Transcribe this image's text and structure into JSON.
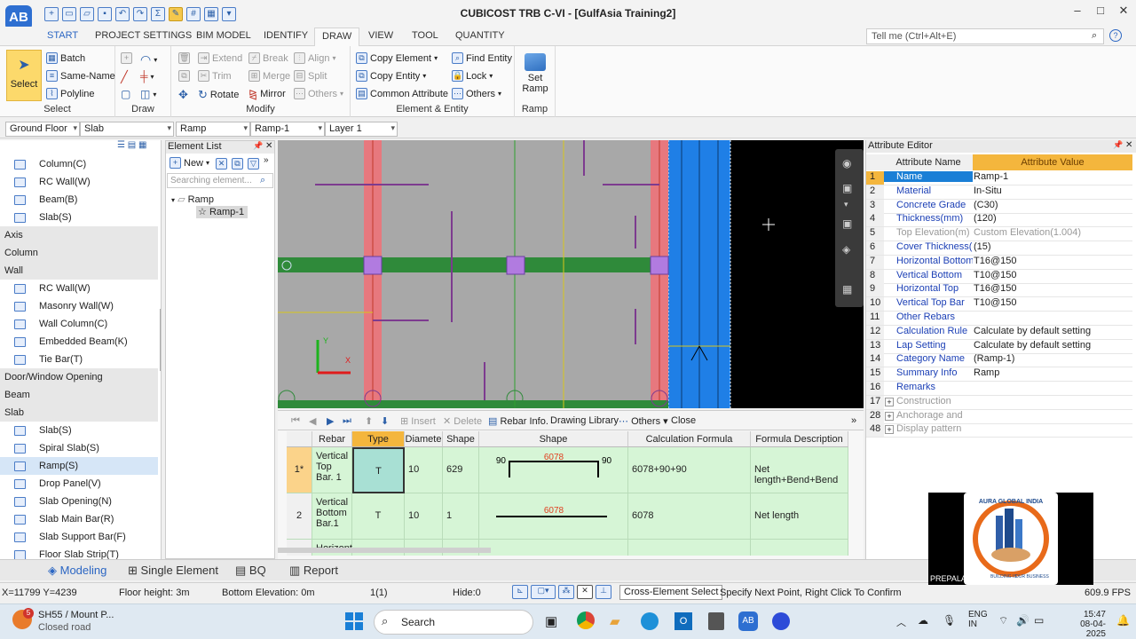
{
  "app": {
    "title": "CUBICOST TRB C-VI - [GulfAsia Training2]",
    "logo": "AB"
  },
  "tabs": [
    "START",
    "PROJECT SETTINGS",
    "BIM MODEL",
    "IDENTIFY",
    "DRAW",
    "VIEW",
    "TOOL",
    "QUANTITY"
  ],
  "active_tab": "DRAW",
  "tellme": {
    "placeholder": "Tell me (Ctrl+Alt+E)"
  },
  "ribbon": {
    "select": {
      "big": "Select",
      "batch": "Batch",
      "same": "Same-Name",
      "poly": "Polyline",
      "label": "Select"
    },
    "draw": {
      "label": "Draw"
    },
    "modify": {
      "extend": "Extend",
      "break": "Break",
      "align": "Align",
      "trim": "Trim",
      "merge": "Merge",
      "split": "Split",
      "rotate": "Rotate",
      "mirror": "Mirror",
      "others": "Others",
      "label": "Modify"
    },
    "element": {
      "copy_el": "Copy Element",
      "find": "Find Entity",
      "copy_ent": "Copy Entity",
      "lock": "Lock",
      "common": "Common Attribute",
      "others": "Others",
      "label": "Element & Entity"
    },
    "ramp": {
      "line1": "Set",
      "line2": "Ramp",
      "label": "Ramp"
    }
  },
  "combos": {
    "floor": "Ground Floor",
    "type": "Slab",
    "elem": "Ramp",
    "name": "Ramp-1",
    "layer": "Layer 1"
  },
  "left_tree": [
    {
      "kind": "item",
      "label": "Column(C)"
    },
    {
      "kind": "item",
      "label": "RC Wall(W)"
    },
    {
      "kind": "item",
      "label": "Beam(B)"
    },
    {
      "kind": "item",
      "label": "Slab(S)"
    },
    {
      "kind": "cat",
      "label": "Axis"
    },
    {
      "kind": "cat",
      "label": "Column"
    },
    {
      "kind": "cat",
      "label": "Wall"
    },
    {
      "kind": "item",
      "label": "RC Wall(W)"
    },
    {
      "kind": "item",
      "label": "Masonry Wall(W)"
    },
    {
      "kind": "item",
      "label": "Wall Column(C)"
    },
    {
      "kind": "item",
      "label": "Embedded Beam(K)"
    },
    {
      "kind": "item",
      "label": "Tie Bar(T)"
    },
    {
      "kind": "cat",
      "label": "Door/Window Opening"
    },
    {
      "kind": "cat",
      "label": "Beam"
    },
    {
      "kind": "cat",
      "label": "Slab"
    },
    {
      "kind": "item",
      "label": "Slab(S)"
    },
    {
      "kind": "item",
      "label": "Spiral Slab(S)"
    },
    {
      "kind": "item",
      "label": "Ramp(S)",
      "selected": true
    },
    {
      "kind": "item",
      "label": "Drop Panel(V)"
    },
    {
      "kind": "item",
      "label": "Slab Opening(N)"
    },
    {
      "kind": "item",
      "label": "Slab Main Bar(R)"
    },
    {
      "kind": "item",
      "label": "Slab Support Bar(F)"
    },
    {
      "kind": "item",
      "label": "Floor Slab Strip(T)"
    }
  ],
  "element_list": {
    "title": "Element List",
    "new": "New",
    "search": "Searching element...",
    "root": "Ramp",
    "child": "Ramp-1"
  },
  "attr_editor": {
    "title": "Attribute Editor",
    "col_name": "Attribute Name",
    "col_value": "Attribute Value",
    "rows": [
      {
        "n": "1",
        "name": "Name",
        "value": "Ramp-1"
      },
      {
        "n": "2",
        "name": "Material",
        "value": "In-Situ"
      },
      {
        "n": "3",
        "name": "Concrete Grade",
        "value": "(C30)"
      },
      {
        "n": "4",
        "name": "Thickness(mm)",
        "value": "(120)"
      },
      {
        "n": "5",
        "name": "Top Elevation(m)",
        "value": "Custom Elevation(1.004)",
        "gray": true
      },
      {
        "n": "6",
        "name": "Cover Thickness(",
        "value": "(15)"
      },
      {
        "n": "7",
        "name": "Horizontal Bottom",
        "value": "T16@150"
      },
      {
        "n": "8",
        "name": "Vertical Bottom",
        "value": "T10@150"
      },
      {
        "n": "9",
        "name": "Horizontal Top",
        "value": "T16@150"
      },
      {
        "n": "10",
        "name": "Vertical Top Bar",
        "value": "T10@150"
      },
      {
        "n": "11",
        "name": "Other Rebars",
        "value": ""
      },
      {
        "n": "12",
        "name": "Calculation Rule",
        "value": "Calculate by default setting"
      },
      {
        "n": "13",
        "name": "Lap Setting",
        "value": "Calculate by default setting"
      },
      {
        "n": "14",
        "name": "Category Name",
        "value": "(Ramp-1)"
      },
      {
        "n": "15",
        "name": "Summary Info",
        "value": "Ramp"
      },
      {
        "n": "16",
        "name": "Remarks",
        "value": ""
      },
      {
        "n": "17",
        "name": "Construction",
        "value": "",
        "gray": true,
        "expand": true
      },
      {
        "n": "28",
        "name": "Anchorage and",
        "value": "",
        "gray": true,
        "expand": true
      },
      {
        "n": "48",
        "name": "Display pattern",
        "value": "",
        "gray": true,
        "expand": true
      }
    ]
  },
  "rebar": {
    "toolbar": {
      "insert": "Insert",
      "delete": "Delete",
      "info": "Rebar Info.",
      "library": "Drawing Library",
      "others": "Others",
      "close": "Close"
    },
    "headers": [
      "Rebar",
      "Type",
      "Diamete",
      "Shape",
      "Shape",
      "Calculation Formula",
      "Formula Description"
    ],
    "rows": [
      {
        "idx": "1*",
        "rebar": "Vertical Top Bar. 1",
        "type": "T",
        "dia": "10",
        "shape": "629",
        "left": "90",
        "mid": "6078",
        "right": "90",
        "formula": "6078+90+90",
        "desc": "Net length+Bend+Bend"
      },
      {
        "idx": "2",
        "rebar": "Vertical Bottom Bar.1",
        "type": "T",
        "dia": "10",
        "shape": "1",
        "left": "",
        "mid": "6078",
        "right": "",
        "formula": "6078",
        "desc": "Net length"
      },
      {
        "idx": "",
        "rebar": "Horizont",
        "type": "",
        "dia": "",
        "shape": "",
        "left": "",
        "mid": "",
        "right": "",
        "formula": "",
        "desc": ""
      }
    ]
  },
  "bottom_tabs": [
    "Modeling",
    "Single Element",
    "BQ",
    "Report"
  ],
  "status": {
    "coords": "X=11799 Y=4239",
    "floor": "Floor height: 3m",
    "bottom": "Bottom Elevation: 0m",
    "count": "1(1)",
    "hide": "Hide:0",
    "cross": "Cross-Element Select",
    "hint": "Specify Next Point, Right Click To Confirm",
    "fps": "609.9 FPS"
  },
  "taskbar": {
    "notif_badge": "5",
    "news_title": "SH55 / Mount P...",
    "news_sub": "Closed road",
    "search": "Search",
    "lang1": "ENG",
    "lang2": "IN",
    "time": "15:47",
    "date": "08-04-2025"
  },
  "ad": {
    "brand": "AURA GLOBAL INDIA",
    "tag1": "BUILDING IS",
    "tag2": "OUR BUSINESS",
    "label": "PREPALAN"
  }
}
